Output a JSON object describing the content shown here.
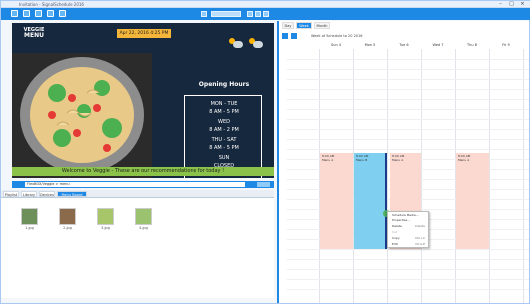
{
  "window": {
    "title": "Invitation - SignalSchedule 2016"
  },
  "signage": {
    "logo_top": "VEGGIE",
    "logo_bottom": "MENU",
    "date": "Apr 22, 2016 4:25 PM",
    "opening_title": "Opening Hours",
    "hours": [
      {
        "days": "MON - TUE",
        "time": "8 AM - 5 PM"
      },
      {
        "days": "WED",
        "time": "8 AM - 2 PM"
      },
      {
        "days": "THU - SAT",
        "time": "8 AM - 5 PM"
      },
      {
        "days": "SUN",
        "time": "CLOSED"
      }
    ],
    "banner": "Welcome to Veggie - These are our recommendations for today !",
    "banner_brand": "Veggie"
  },
  "url": {
    "value": "FlexBOX/Veggie > menu"
  },
  "left_tabs": [
    "Playlist",
    "Library",
    "Devices",
    "Menu Board"
  ],
  "thumbs": [
    "1.jpg",
    "2.jpg",
    "3.jpg",
    "4.jpg"
  ],
  "calendar": {
    "view_tabs": [
      "Day",
      "Week",
      "Month"
    ],
    "active_view": "Week",
    "week_info": "Week of Schedule to 20 2016",
    "days": [
      "Sun 4",
      "Mon 5",
      "Tue 6",
      "Wed 7",
      "Thu 8",
      "Fri 9",
      "Sat 10"
    ],
    "appointments": [
      {
        "title": "8:00 AM",
        "subtitle": "Menu A"
      },
      {
        "title": "8:00 AM",
        "subtitle": "Menu B"
      },
      {
        "title": "8:00 AM",
        "subtitle": "Menu A"
      },
      {
        "title": "8:00 AM",
        "subtitle": "Menu A"
      }
    ],
    "context_menu": [
      {
        "label": "Schedule Media...",
        "key": ""
      },
      {
        "label": "Properties...",
        "key": ""
      },
      {
        "label": "Delete",
        "key": "Delete"
      },
      {
        "label": "Cut",
        "key": ""
      },
      {
        "label": "Copy",
        "key": "Ctrl+C"
      },
      {
        "label": "Edit",
        "key": "Ctrl+E"
      }
    ]
  }
}
